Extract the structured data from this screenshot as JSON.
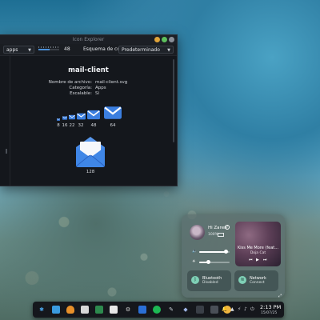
{
  "window": {
    "title": "Icon Explorer",
    "theme_combo": "apps",
    "size_value": "48",
    "size_fraction": 0.55,
    "scheme_label": "Esquema de color:",
    "scheme_value": "Predeterminado"
  },
  "icon": {
    "name": "mail-client",
    "meta": [
      {
        "key": "Nombre de archivo:",
        "value": "mail-client.svg"
      },
      {
        "key": "Categoría:",
        "value": "Apps"
      },
      {
        "key": "Escalable:",
        "value": "Sí"
      }
    ],
    "sizes": [
      "8",
      "16",
      "22",
      "32",
      "48",
      "64"
    ],
    "large_size": "128"
  },
  "quick_settings": {
    "greeting": "Hi Zaren",
    "help": "?",
    "battery": "100%",
    "volume_fraction": 0.88,
    "brightness_fraction": 0.3,
    "media": {
      "title": "Kiss Me More (feat...",
      "artist": "Doja Cat",
      "prev": "⏮",
      "play": "▶",
      "next": "⏭"
    },
    "bluetooth": {
      "name": "Bluetooth",
      "state": "Disabled"
    },
    "network": {
      "name": "Network",
      "state": "Connect"
    },
    "expand": "⤢"
  },
  "taskbar": {
    "time": "2:13 PM",
    "date": "15/07/25",
    "tray": [
      "🔔",
      "▲",
      "⚡",
      "♪",
      "⏻"
    ]
  },
  "colors": {
    "accent": "#4a90d9",
    "mail_blue": "#3b7fe0"
  }
}
